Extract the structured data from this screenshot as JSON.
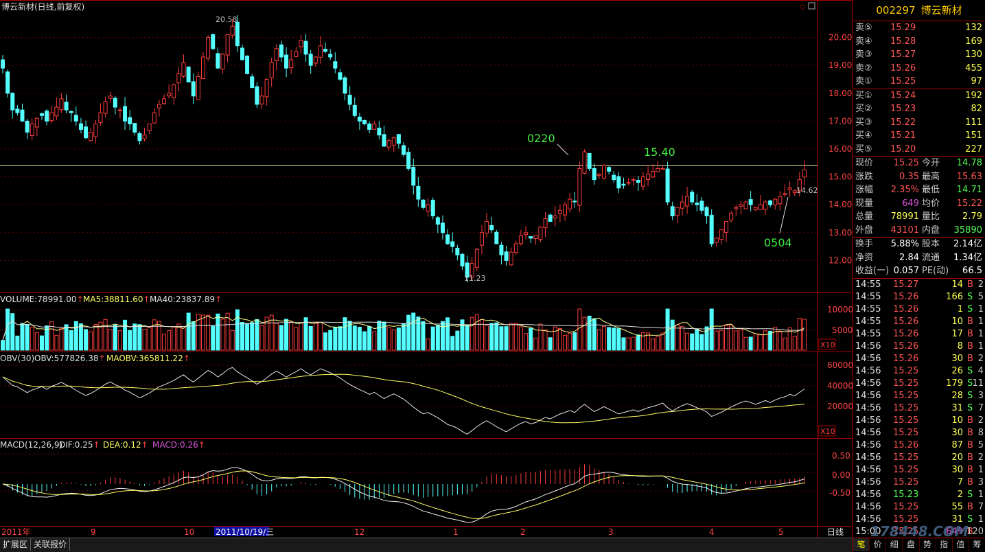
{
  "header": {
    "title": "博云新材(日线,前复权)"
  },
  "price_axis": {
    "ticks": [
      "20.00",
      "19.00",
      "18.00",
      "17.00",
      "16.00",
      "15.00",
      "14.00",
      "13.00",
      "12.00"
    ]
  },
  "volume_axis": {
    "ticks": [
      "10000",
      "5000"
    ],
    "unit": "X10"
  },
  "obv_axis": {
    "ticks": [
      "60000",
      "40000",
      "20000"
    ],
    "unit": "X10"
  },
  "macd_axis": {
    "ticks": [
      "0.50",
      "0.00",
      "-0.50"
    ]
  },
  "date_axis": {
    "labels": [
      "2011年",
      "9",
      "10",
      "2011/10/19/三",
      "12",
      "1",
      "2",
      "3",
      "4",
      "5"
    ],
    "period": "日线"
  },
  "annotations": {
    "high": "20.58",
    "low": "11.23",
    "label_0220": "0220",
    "label_1540": "15.40",
    "label_0504": "0504",
    "last_marker": "14.62"
  },
  "indicators": {
    "volume": {
      "name": "VOLUME:",
      "value": "78991.00",
      "ma5_label": "MA5:",
      "ma5": "38811.60",
      "ma40_label": "MA40:",
      "ma40": "23837.89"
    },
    "obv": {
      "name": "OBV(30)",
      "obv_label": "OBV:",
      "obv": "577826.38",
      "maobv_label": "MAOBV:",
      "maobv": "365811.22"
    },
    "macd": {
      "name": "MACD(12,26,9)",
      "dif_label": "DIF:",
      "dif": "0.25",
      "dea_label": "DEA:",
      "dea": "0.12",
      "macd_label": "MACD:",
      "macd": "0.26"
    }
  },
  "chart_data": {
    "type": "candlestick",
    "y_range": [
      11.0,
      20.9
    ],
    "reference_line": 15.4,
    "closes": [
      18.9,
      18.0,
      17.4,
      17.3,
      17.0,
      16.6,
      16.9,
      17.1,
      17.2,
      17.0,
      17.3,
      17.5,
      17.8,
      17.4,
      17.3,
      17.0,
      16.7,
      16.4,
      16.6,
      16.9,
      17.3,
      17.7,
      17.9,
      17.5,
      17.4,
      17.0,
      16.9,
      16.6,
      16.3,
      16.5,
      16.9,
      17.3,
      17.6,
      17.8,
      18.0,
      18.3,
      18.7,
      19.1,
      18.4,
      17.9,
      18.6,
      19.3,
      20.0,
      19.6,
      18.9,
      19.4,
      20.1,
      20.4,
      19.7,
      19.2,
      18.7,
      18.2,
      17.6,
      17.9,
      18.5,
      19.1,
      19.6,
      19.3,
      18.9,
      19.2,
      19.5,
      19.9,
      19.4,
      19.0,
      19.3,
      19.7,
      19.5,
      19.3,
      18.9,
      18.5,
      18.0,
      17.6,
      17.2,
      17.0,
      16.9,
      16.7,
      16.9,
      16.5,
      16.1,
      16.3,
      16.4,
      16.2,
      15.8,
      15.3,
      14.7,
      14.2,
      13.9,
      14.0,
      13.6,
      13.3,
      13.0,
      12.6,
      12.5,
      12.2,
      11.8,
      11.4,
      11.9,
      12.4,
      13.0,
      13.4,
      13.1,
      12.6,
      12.2,
      12.0,
      12.3,
      12.6,
      12.9,
      13.0,
      12.8,
      12.9,
      13.2,
      13.5,
      13.4,
      13.6,
      13.8,
      14.0,
      14.2,
      14.1,
      15.3,
      15.9,
      15.3,
      14.9,
      15.1,
      15.4,
      15.2,
      14.9,
      14.6,
      14.7,
      14.8,
      14.9,
      14.8,
      15.0,
      15.1,
      15.2,
      15.3,
      15.3,
      14.1,
      13.6,
      13.9,
      14.1,
      14.3,
      14.1,
      14.0,
      13.8,
      13.6,
      12.6,
      12.8,
      13.1,
      13.4,
      13.7,
      13.9,
      14.0,
      14.1,
      14.0,
      13.9,
      14.0,
      14.1,
      14.0,
      14.2,
      14.3,
      14.4,
      14.6,
      14.5,
      14.9,
      15.25
    ],
    "volume_ma": [
      "MA5",
      "MA40"
    ],
    "obv_range": [
      0,
      60000
    ],
    "macd_range": [
      -0.75,
      0.75
    ]
  },
  "panel": {
    "code": "002297",
    "name": "博云新材",
    "asks": [
      {
        "label": "卖⑤",
        "price": "15.29",
        "vol": "132"
      },
      {
        "label": "卖④",
        "price": "15.28",
        "vol": "169"
      },
      {
        "label": "卖③",
        "price": "15.27",
        "vol": "130"
      },
      {
        "label": "卖②",
        "price": "15.26",
        "vol": "455"
      },
      {
        "label": "卖①",
        "price": "15.25",
        "vol": "97"
      }
    ],
    "bids": [
      {
        "label": "买①",
        "price": "15.24",
        "vol": "192"
      },
      {
        "label": "买②",
        "price": "15.23",
        "vol": "82"
      },
      {
        "label": "买③",
        "price": "15.22",
        "vol": "111"
      },
      {
        "label": "买④",
        "price": "15.21",
        "vol": "151"
      },
      {
        "label": "买⑤",
        "price": "15.20",
        "vol": "227"
      }
    ],
    "quotes": [
      {
        "l1": "现价",
        "v1": "15.25",
        "c1": "#ff5555",
        "l2": "今开",
        "v2": "14.78",
        "c2": "#55ff55"
      },
      {
        "l1": "涨跌",
        "v1": "0.35",
        "c1": "#ff5555",
        "l2": "最高",
        "v2": "15.63",
        "c2": "#ff5555"
      },
      {
        "l1": "涨幅",
        "v1": "2.35%",
        "c1": "#ff5555",
        "l2": "最低",
        "v2": "14.71",
        "c2": "#55ff55"
      },
      {
        "l1": "现量",
        "v1": "649",
        "c1": "#dd55dd",
        "l2": "均价",
        "v2": "15.22",
        "c2": "#ff5555"
      },
      {
        "l1": "总量",
        "v1": "78991",
        "c1": "#ffff55",
        "l2": "量比",
        "v2": "2.79",
        "c2": "#ffff55"
      },
      {
        "l1": "外盘",
        "v1": "43101",
        "c1": "#ff5555",
        "l2": "内盘",
        "v2": "35890",
        "c2": "#55ff55"
      }
    ],
    "fundamentals": [
      {
        "l1": "换手",
        "v1": "5.88%",
        "l2": "股本",
        "v2": "2.14亿"
      },
      {
        "l1": "净资",
        "v1": "2.84",
        "l2": "流通",
        "v2": "1.34亿"
      },
      {
        "l1": "收益(一)",
        "v1": "0.057",
        "l2": "PE(动)",
        "v2": "66.5"
      }
    ],
    "ticks": [
      {
        "t": "14:55",
        "p": "15.27",
        "v": "14",
        "bs": "B",
        "n": "2"
      },
      {
        "t": "14:55",
        "p": "15.26",
        "v": "166",
        "bs": "S",
        "n": "5"
      },
      {
        "t": "14:55",
        "p": "15.26",
        "v": "1",
        "bs": "S",
        "n": "1"
      },
      {
        "t": "14:55",
        "p": "15.26",
        "v": "10",
        "bs": "B",
        "n": "1"
      },
      {
        "t": "14:55",
        "p": "15.26",
        "v": "17",
        "bs": "B",
        "n": "1"
      },
      {
        "t": "14:56",
        "p": "15.26",
        "v": "8",
        "bs": "B",
        "n": "1"
      },
      {
        "t": "14:56",
        "p": "15.26",
        "v": "30",
        "bs": "B",
        "n": "2"
      },
      {
        "t": "14:56",
        "p": "15.25",
        "v": "26",
        "bs": "S",
        "n": "4"
      },
      {
        "t": "14:56",
        "p": "15.25",
        "v": "179",
        "bs": "S",
        "n": "11"
      },
      {
        "t": "14:56",
        "p": "15.25",
        "v": "28",
        "bs": "S",
        "n": "3"
      },
      {
        "t": "14:56",
        "p": "15.25",
        "v": "31",
        "bs": "S",
        "n": "7"
      },
      {
        "t": "14:56",
        "p": "15.25",
        "v": "10",
        "bs": "B",
        "n": "2"
      },
      {
        "t": "14:56",
        "p": "15.25",
        "v": "30",
        "bs": "B",
        "n": "8"
      },
      {
        "t": "14:56",
        "p": "15.26",
        "v": "87",
        "bs": "B",
        "n": "5"
      },
      {
        "t": "14:56",
        "p": "15.25",
        "v": "20",
        "bs": "B",
        "n": "2"
      },
      {
        "t": "14:56",
        "p": "15.25",
        "v": "30",
        "bs": "B",
        "n": "1"
      },
      {
        "t": "14:56",
        "p": "15.25",
        "v": "7",
        "bs": "B",
        "n": "3"
      },
      {
        "t": "14:56",
        "p": "15.23",
        "v": "2",
        "bs": "S",
        "n": "1"
      },
      {
        "t": "14:56",
        "p": "15.25",
        "v": "55",
        "bs": "B",
        "n": "7"
      },
      {
        "t": "14:56",
        "p": "15.25",
        "v": "31",
        "bs": "S",
        "n": "1"
      },
      {
        "t": "15:00",
        "p": "15.25",
        "v": "649",
        "bs": "B",
        "n": "120"
      }
    ],
    "tabs": [
      "笔",
      "价",
      "细",
      "盘",
      "势",
      "指",
      "值",
      "筹"
    ]
  },
  "bottom_bar": {
    "items": [
      "扩展区",
      "关联报价"
    ]
  },
  "watermark": "178448.COM"
}
